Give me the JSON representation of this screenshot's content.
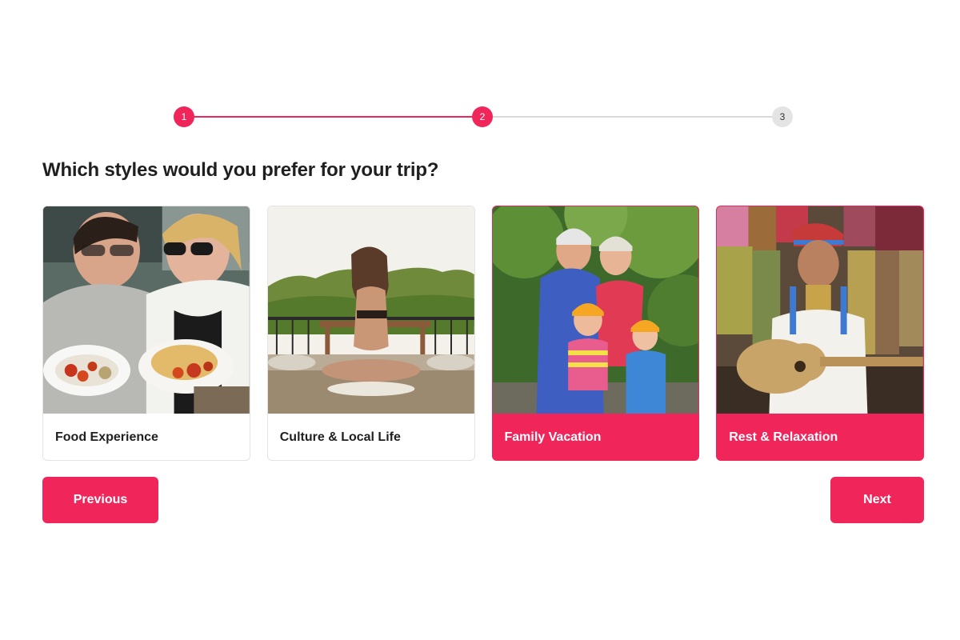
{
  "stepper": {
    "steps": [
      {
        "label": "1",
        "state": "done"
      },
      {
        "label": "2",
        "state": "done"
      },
      {
        "label": "3",
        "state": "todo"
      }
    ],
    "current": 2,
    "total": 3
  },
  "question": "Which styles would you prefer for your trip?",
  "options": [
    {
      "label": "Food Experience",
      "selected": false
    },
    {
      "label": "Culture & Local Life",
      "selected": false
    },
    {
      "label": "Family Vacation",
      "selected": true
    },
    {
      "label": "Rest & Relaxation",
      "selected": true
    }
  ],
  "buttons": {
    "previous": "Previous",
    "next": "Next"
  },
  "colors": {
    "accent": "#f0265b",
    "inactive_step": "#e4e4e4",
    "card_border": "#e3e3e3"
  }
}
